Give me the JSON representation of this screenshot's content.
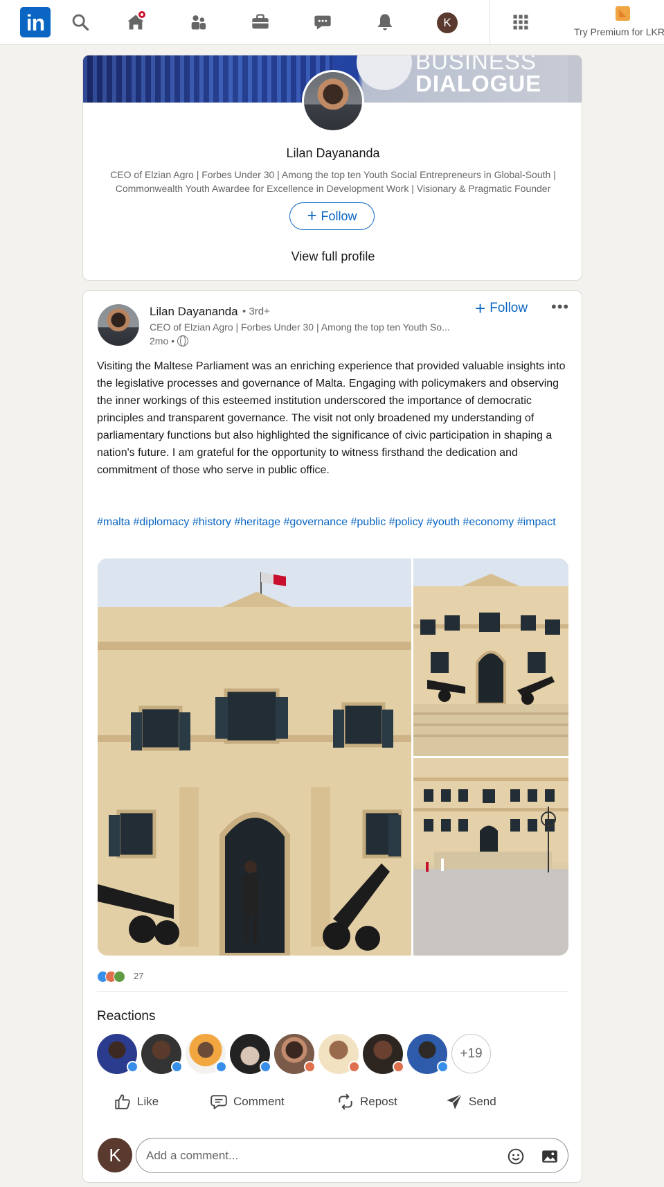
{
  "nav": {
    "logo_text": "in",
    "icons": [
      "search-icon",
      "home-icon",
      "my-network-icon",
      "jobs-icon",
      "messaging-icon",
      "notifications-icon",
      "me-avatar",
      "apps-grid-icon"
    ],
    "me_initial": "K",
    "premium_label": "Try Premium for LKR",
    "accent_color": "#0a66c2"
  },
  "profile_card": {
    "banner_text_line1": "BUSINESS",
    "banner_text_line2": "DIALOGUE",
    "name": "Lilan Dayananda",
    "headline": "CEO of Elzian Agro | Forbes Under 30 | Among the top ten Youth Social Entrepreneurs in Global-South | Commonwealth Youth Awardee for Excellence in Development Work | Visionary & Pragmatic Founder",
    "follow_label": "Follow",
    "view_profile_label": "View full profile"
  },
  "post": {
    "author_name": "Lilan Dayananda",
    "degree": "• 3rd+",
    "author_headline": "CEO of Elzian Agro | Forbes Under 30 | Among the top ten Youth So...",
    "time": "2mo •",
    "follow_label": "Follow",
    "more_label": "•••",
    "body": "Visiting the Maltese Parliament was an enriching experience that provided valuable insights into the legislative processes and governance of Malta. Engaging with policymakers and observing the inner workings of this esteemed institution underscored the importance of democratic principles and transparent governance. The visit not only broadened my understanding of parliamentary functions but also highlighted the significance of civic participation in shaping a nation's future. I am grateful for the opportunity to witness firsthand the dedication and commitment of those who serve in public office.",
    "hashtags": [
      "#malta",
      "#diplomacy",
      "#history",
      "#heritage",
      "#governance",
      "#public",
      "#policy",
      "#youth",
      "#economy",
      "#impact"
    ],
    "reaction_count": "27",
    "reactions_title": "Reactions",
    "more_reactors": "+19",
    "actions": {
      "like": "Like",
      "comment": "Comment",
      "repost": "Repost",
      "send": "Send"
    },
    "commenter_initial": "K",
    "comment_placeholder": "Add a comment..."
  }
}
